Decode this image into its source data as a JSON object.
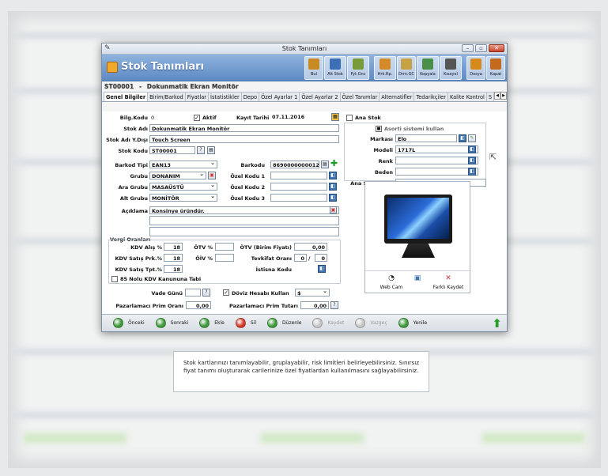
{
  "window": {
    "title": "Stok Tanımları",
    "header_title": "Stok Tanımları",
    "stock_line": {
      "code": "ST00001",
      "separator": "-",
      "name": "Dokunmatik Ekran Monitör"
    }
  },
  "toolbar": [
    {
      "label": "Bul",
      "icon": "search-icon",
      "color": "#c98a24"
    },
    {
      "label": "Alt Stok",
      "icon": "substock-icon",
      "color": "#3d6fb5"
    },
    {
      "label": "Fyt.Gnc",
      "icon": "price-update-icon",
      "color": "#7a9b3c"
    },
    {
      "label": "Hrk.Rp.",
      "icon": "movement-report-icon",
      "color": "#d48a2a"
    },
    {
      "label": "Drm.GC",
      "icon": "status-icon",
      "color": "#c7a245"
    },
    {
      "label": "Kopyala",
      "icon": "copy-icon",
      "color": "#4a8e4a"
    },
    {
      "label": "Kısayol",
      "icon": "shortcut-icon",
      "color": "#555555"
    },
    {
      "label": "Dosya",
      "icon": "file-icon",
      "color": "#d78a1c"
    },
    {
      "label": "Kapat",
      "icon": "close-icon",
      "color": "#c46a1c"
    }
  ],
  "tabs": [
    "Genel Bilgiler",
    "Birim/Barkod",
    "Fiyatlar",
    "İstatistikler",
    "Depo",
    "Özel Ayarlar 1",
    "Özel Ayarlar 2",
    "Özel Tanımlar",
    "Alternatifler",
    "Tedarikçiler",
    "Kalite Kontrol",
    "S"
  ],
  "form": {
    "bilg_kodu_label": "Bilg.Kodu",
    "bilg_kodu_value": "0",
    "aktif_label": "Aktif",
    "kayit_tarihi_label": "Kayıt Tarihi",
    "kayit_tarihi_value": "07.11.2016",
    "ana_stok_label": "Ana Stok",
    "stok_adi_label": "Stok Adı",
    "stok_adi_value": "Dokunmatik Ekran Monitör",
    "stok_adi_ydisi_label": "Stok Adı Y.Dışı",
    "stok_adi_ydisi_value": "Touch Screen",
    "stok_kodu_label": "Stok Kodu",
    "stok_kodu_value": "ST00001",
    "barkod_tipi_label": "Barkod Tipi",
    "barkod_tipi_value": "EAN13",
    "barkodu_label": "Barkodu",
    "barkodu_value": "8690000000012",
    "grubu_label": "Grubu",
    "grubu_value": "DONANIM",
    "ozel_kodu1_label": "Özel Kodu 1",
    "ara_grubu_label": "Ara Grubu",
    "ara_grubu_value": "MASAÜSTÜ",
    "ozel_kodu2_label": "Özel Kodu 2",
    "alt_grubu_label": "Alt Grubu",
    "alt_grubu_value": "MONİTÖR",
    "ozel_kodu3_label": "Özel Kodu 3",
    "aciklama_label": "Açıklama",
    "aciklama_value": "Konsinye üründür.",
    "asorti_label": "Asorti sistemi kullan",
    "markasi_label": "Markası",
    "markasi_value": "Elo",
    "modeli_label": "Modeli",
    "modeli_value": "1717L",
    "renk_label": "Renk",
    "beden_label": "Beden",
    "ana_stok_kodu_label": "Ana Stok Kodu"
  },
  "tax": {
    "section_title": "Vergi Oranları",
    "kdv_alis_label": "KDV Alış %",
    "kdv_alis_value": "18",
    "otv_pct_label": "ÖTV %",
    "otv_birim_label": "ÖTV (Birim Fiyatı)",
    "otv_birim_value": "0,00",
    "kdv_satis_prk_label": "KDV Satış Prk.%",
    "kdv_satis_prk_value": "18",
    "oiv_pct_label": "ÖİV %",
    "tevkifat_label": "Tevkifat Oranı",
    "tevkifat_a": "0",
    "tevkifat_sep": "/",
    "tevkifat_b": "0",
    "kdv_satis_tpt_label": "KDV Satış Tpt.%",
    "kdv_satis_tpt_value": "18",
    "istisna_label": "İstisna Kodu",
    "kdv_85_label": "85 Nolu KDV Kanununa Tabi"
  },
  "payment": {
    "vade_label": "Vade Günü",
    "doviz_label": "Döviz Hesabı Kullan",
    "doviz_value": "$",
    "prim_orani_label": "Pazarlamacı Prim Oranı",
    "prim_orani_value": "0,00",
    "prim_tutari_label": "Pazarlamacı Prim Tutarı",
    "prim_tutari_value": "0,00"
  },
  "image_panel": {
    "webcam_label": "Web Cam",
    "save_as_label": "Farklı Kaydet"
  },
  "bottombar": [
    {
      "label": "Önceki",
      "color": "#3e9a3a",
      "enabled": true
    },
    {
      "label": "Sonraki",
      "color": "#3e9a3a",
      "enabled": true
    },
    {
      "label": "Ekle",
      "color": "#3e9a3a",
      "enabled": true
    },
    {
      "label": "Sil",
      "color": "#d23a2a",
      "enabled": true
    },
    {
      "label": "Düzenle",
      "color": "#3e9a3a",
      "enabled": true
    },
    {
      "label": "Kaydet",
      "color": "#c7c7c7",
      "enabled": false
    },
    {
      "label": "Vazgeç",
      "color": "#c7c7c7",
      "enabled": false
    },
    {
      "label": "Yenile",
      "color": "#3e9a3a",
      "enabled": true
    }
  ],
  "caption": "Stok kartlarınızı tanımlayabilir, gruplayabilir, risk limitleri belirleyebilirsiniz. Sınırsız fiyat tanımı oluşturarak carilerinize özel fiyatlardan kullanılmasını sağlayabilirsiniz."
}
